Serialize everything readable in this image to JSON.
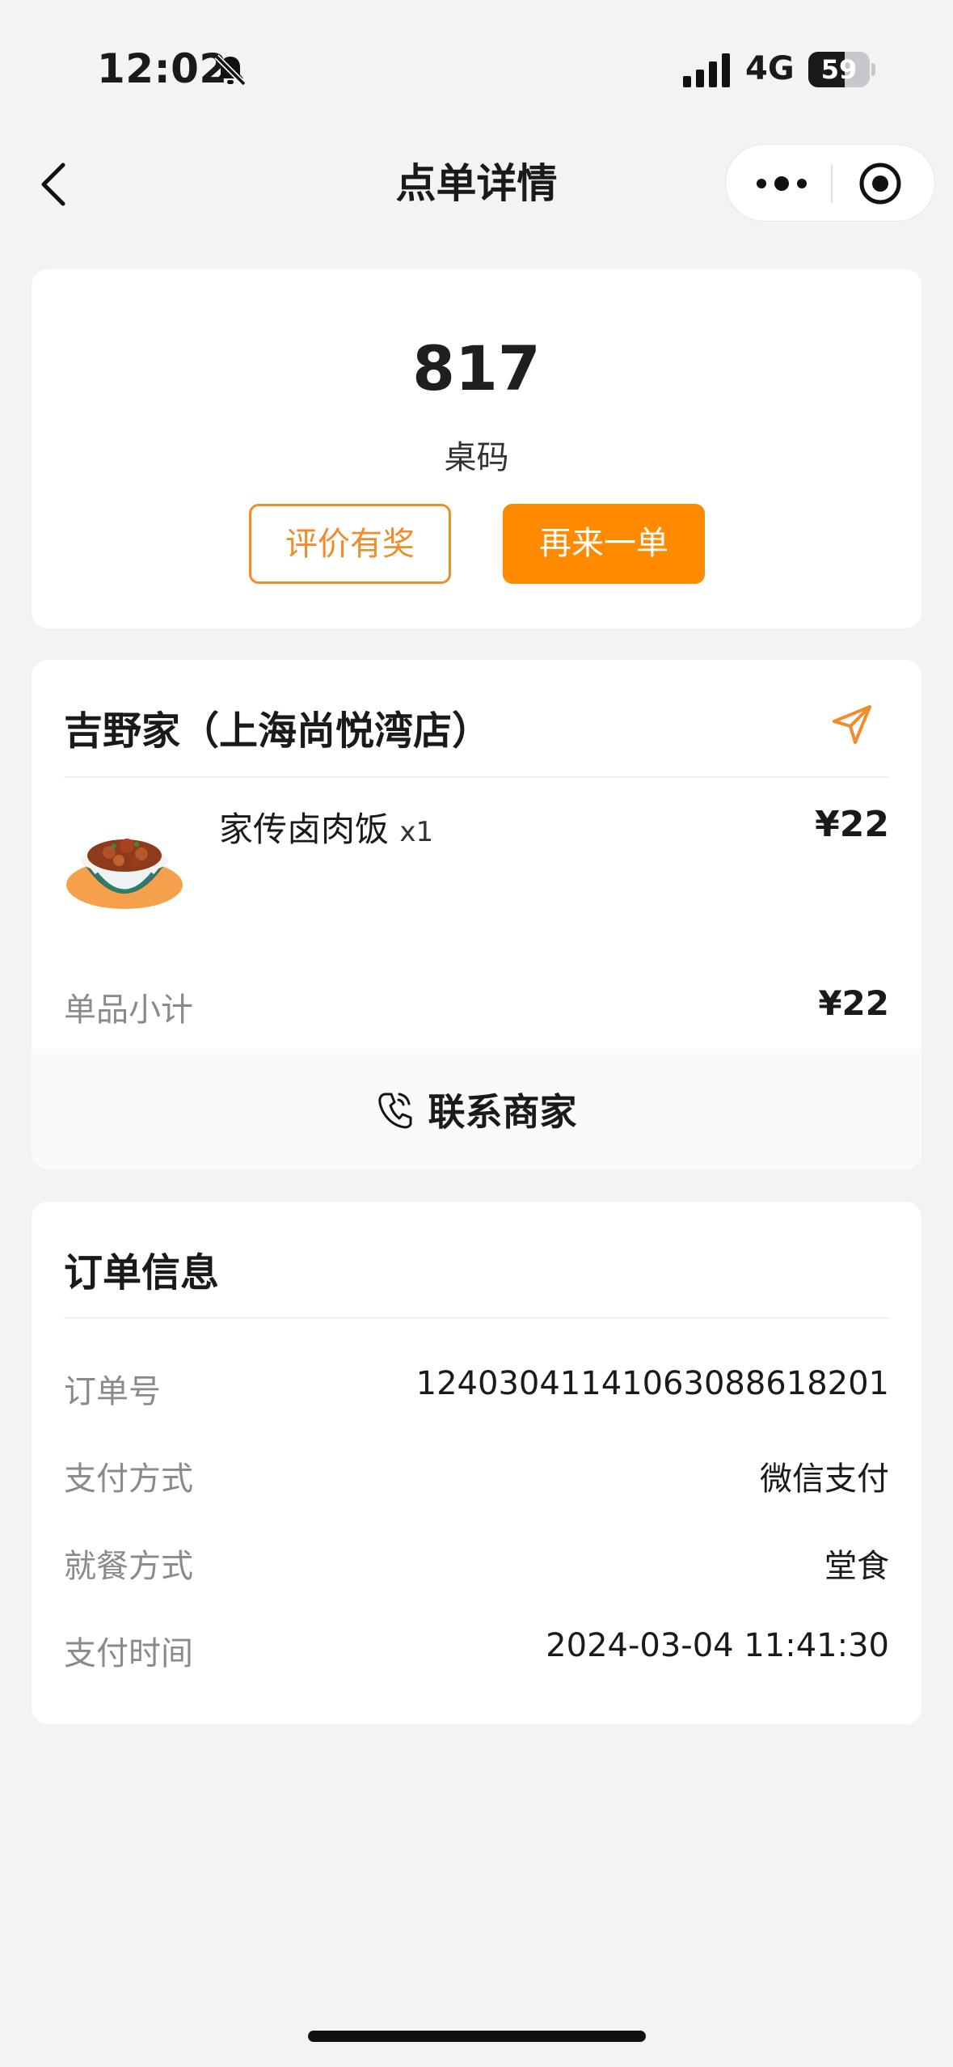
{
  "status_bar": {
    "time": "12:02",
    "network": "4G",
    "battery_level": "59",
    "battery_fraction": 0.59
  },
  "nav": {
    "title": "点单详情",
    "back_icon": "chevron-left-icon",
    "more_icon": "more-dots-icon",
    "close_icon": "target-circle-icon"
  },
  "table": {
    "number": "817",
    "label": "桌码",
    "review_button": "评价有奖",
    "reorder_button": "再来一单"
  },
  "shop": {
    "name": "吉野家（上海尚悦湾店）",
    "items": [
      {
        "name": "家传卤肉饭",
        "qty": "x1",
        "price": "¥22"
      }
    ],
    "subtotal_label": "单品小计",
    "subtotal_value": "¥22",
    "contact_label": "联系商家"
  },
  "order_info": {
    "title": "订单信息",
    "rows": [
      {
        "label": "订单号",
        "value": "1240304114106308861820​1"
      },
      {
        "label": "支付方式",
        "value": "微信支付"
      },
      {
        "label": "就餐方式",
        "value": "堂食"
      },
      {
        "label": "支付时间",
        "value": "2024-03-04 11:41:30"
      }
    ]
  },
  "colors": {
    "accent": "#ff8a00",
    "accent_border": "#f08c2c",
    "background": "#f2f3f5"
  }
}
